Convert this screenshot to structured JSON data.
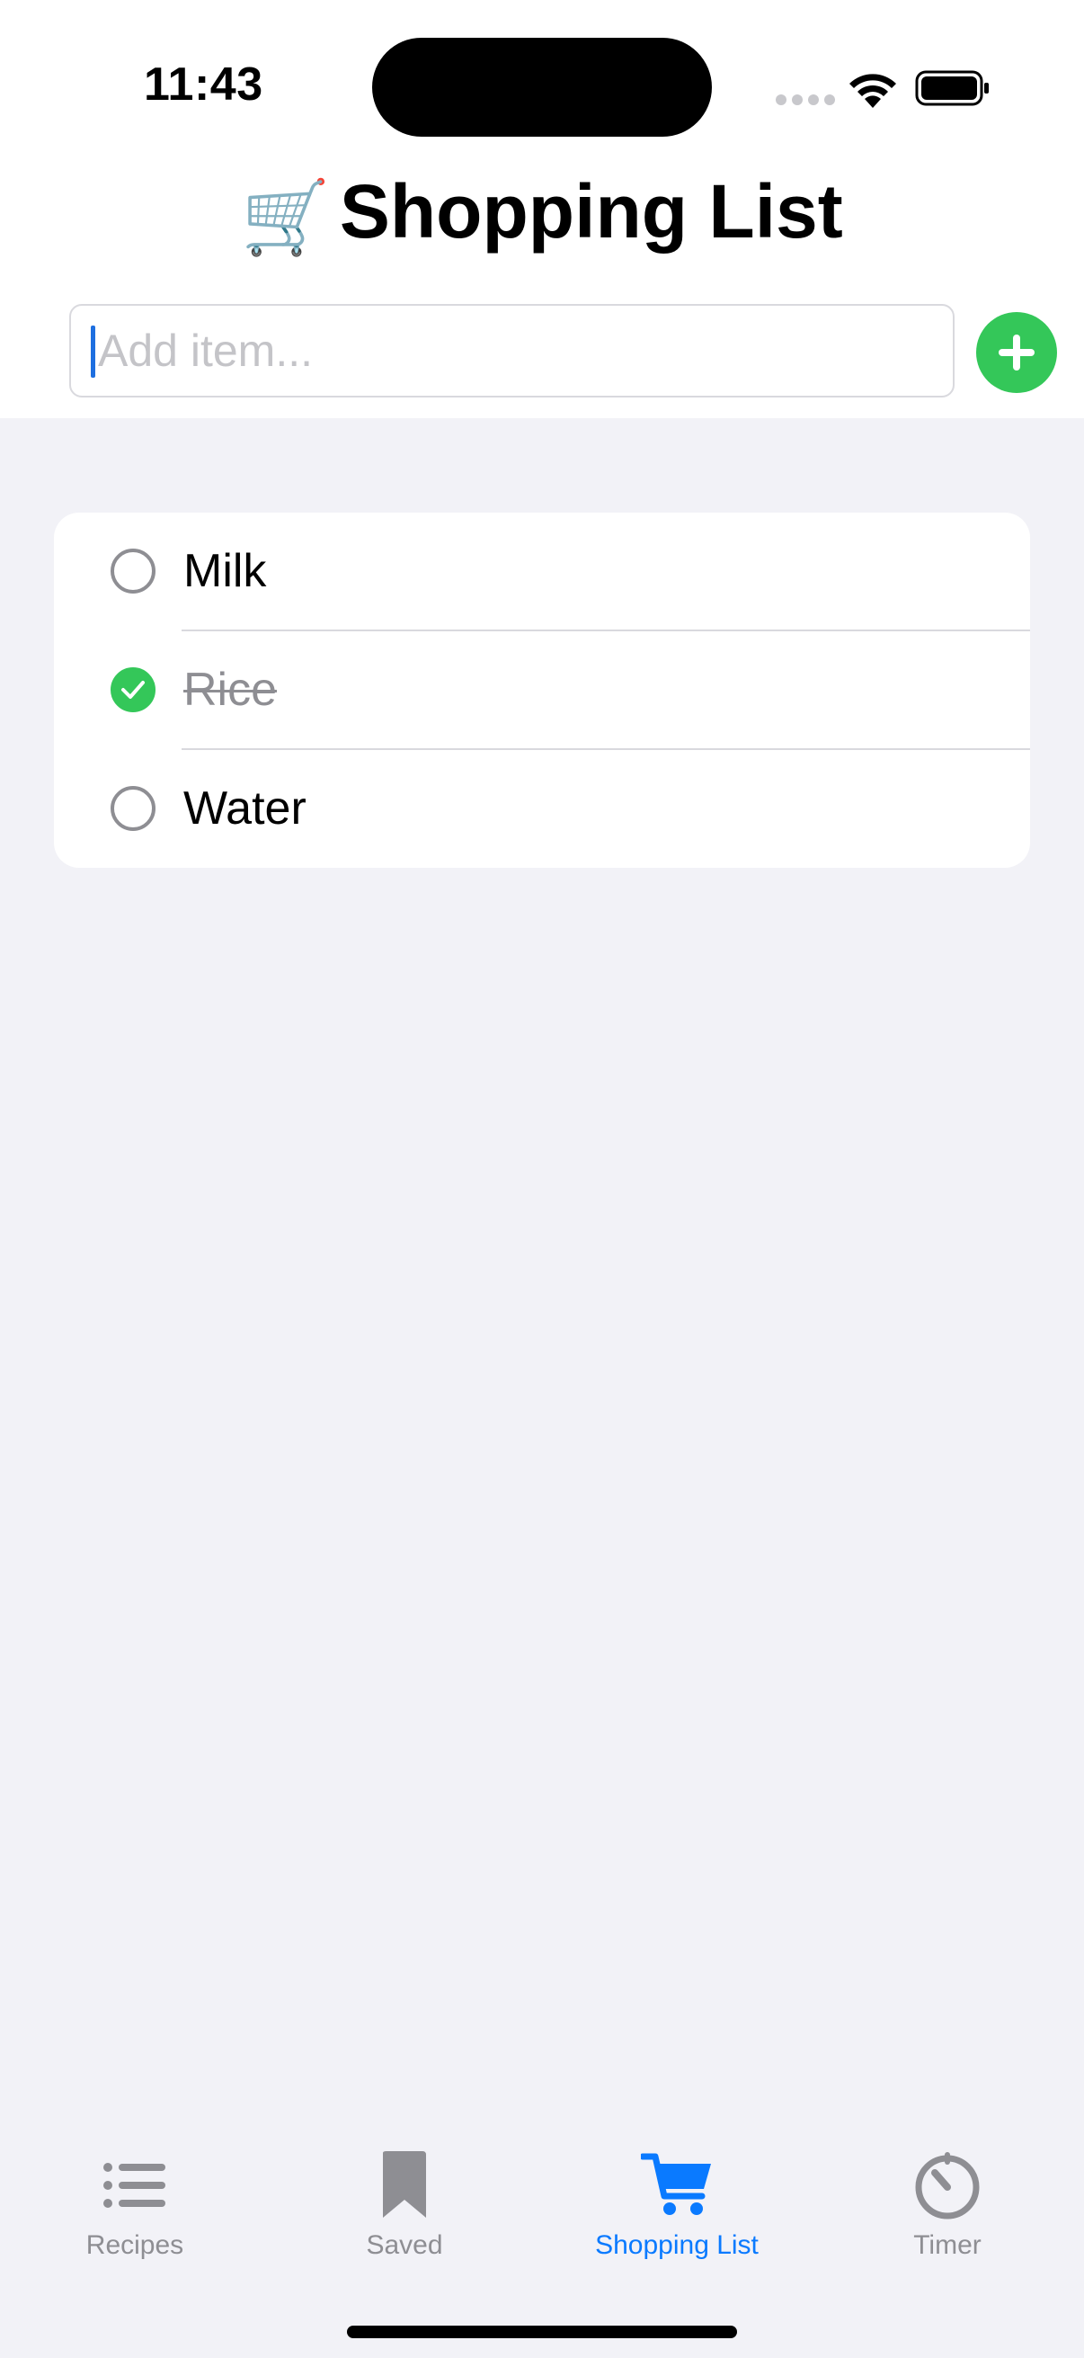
{
  "status_bar": {
    "time": "11:43"
  },
  "header": {
    "emoji": "🛒",
    "title": "Shopping List"
  },
  "input": {
    "placeholder": "Add item...",
    "value": ""
  },
  "add_button": {
    "icon": "plus-icon",
    "color": "#34C759"
  },
  "items": [
    {
      "label": "Milk",
      "checked": false
    },
    {
      "label": "Rice",
      "checked": true
    },
    {
      "label": "Water",
      "checked": false
    }
  ],
  "tabs": [
    {
      "label": "Recipes",
      "icon": "list-icon",
      "active": false
    },
    {
      "label": "Saved",
      "icon": "bookmark-icon",
      "active": false
    },
    {
      "label": "Shopping List",
      "icon": "cart-icon",
      "active": true
    },
    {
      "label": "Timer",
      "icon": "timer-icon",
      "active": false
    }
  ],
  "colors": {
    "accent": "#0A7AFF",
    "check": "#34C759",
    "inactive": "#8E8E93",
    "background": "#F2F2F7"
  }
}
